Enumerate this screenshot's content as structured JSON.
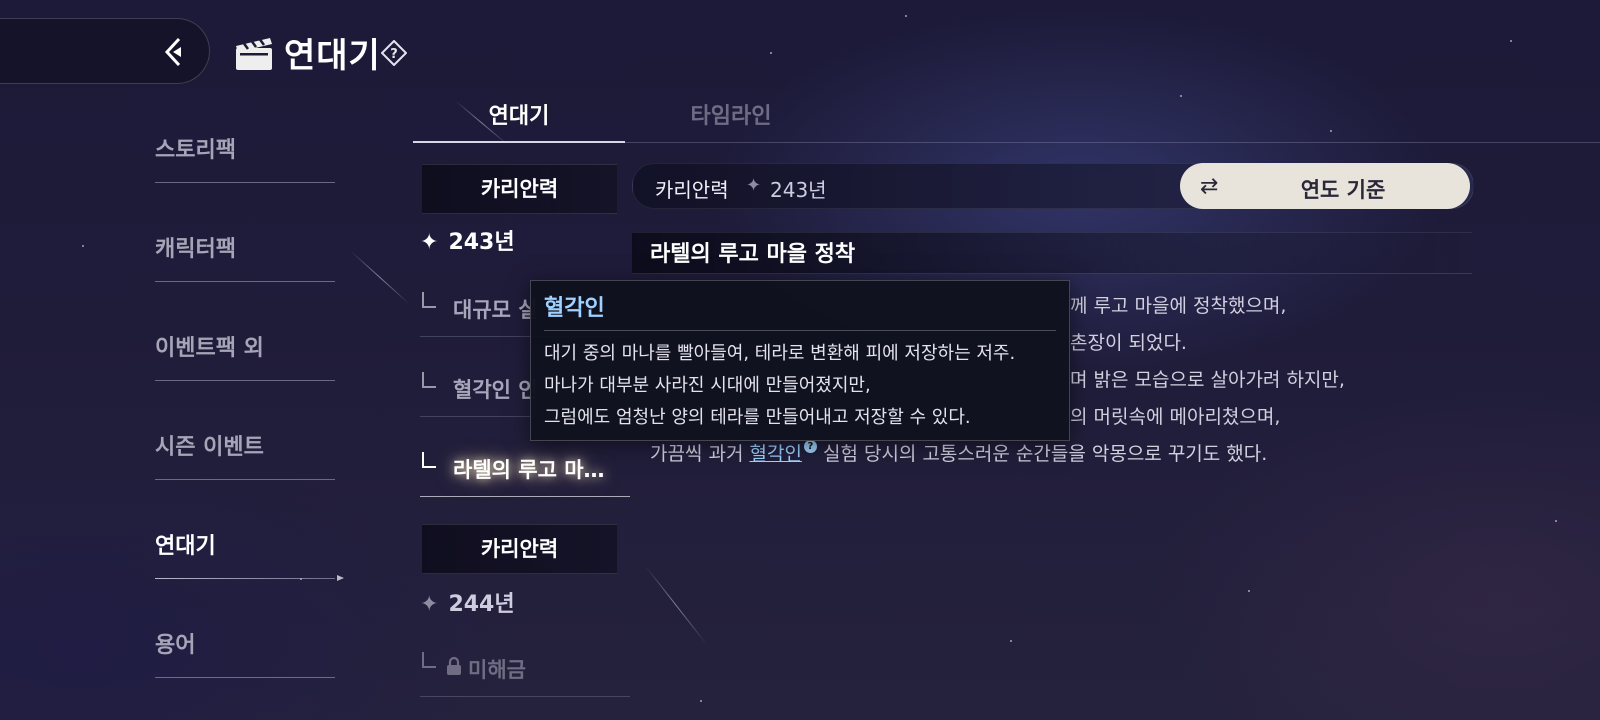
{
  "header": {
    "title": "연대기"
  },
  "sidebar": {
    "items": [
      {
        "label": "스토리팩"
      },
      {
        "label": "캐릭터팩"
      },
      {
        "label": "이벤트팩 외"
      },
      {
        "label": "시즌 이벤트"
      },
      {
        "label": "연대기"
      },
      {
        "label": "용어"
      }
    ],
    "active_index": 4
  },
  "tabs": [
    {
      "label": "연대기",
      "active": true
    },
    {
      "label": "타임라인",
      "active": false
    }
  ],
  "chronicle": {
    "groups": [
      {
        "era": "카리안력",
        "year": "243년",
        "entries": [
          {
            "title": "대규모 실",
            "state": "normal"
          },
          {
            "title": "혈각인 인",
            "state": "normal"
          },
          {
            "title": "라텔의 루고 마…",
            "state": "active"
          }
        ]
      },
      {
        "era": "카리안력",
        "year": "244년",
        "entries": [
          {
            "title": "미해금",
            "state": "locked"
          }
        ]
      }
    ]
  },
  "content": {
    "breadcrumb_era": "카리안력",
    "breadcrumb_year": "243년",
    "sort_button_label": "연도 기준",
    "entry_title": "라텔의 루고 마을 정착",
    "paragraph_fragments": [
      "께 루고 마을에 정착했으며,",
      "촌장이 되었다.",
      "며 밝은 모습으로 살아가려 하지만,",
      "의 머릿속에 메아리쳤으며,"
    ],
    "last_line_prefix": "가끔씩 과거 ",
    "last_line_keyword": "혈각인",
    "last_line_suffix": " 실험 당시의 고통스러운 순간들을 악몽으로 꾸기도 했다."
  },
  "tooltip": {
    "title": "혈각인",
    "lines": [
      "대기 중의 마나를 빨아들여, 테라로 변환해 피에 저장하는 저주.",
      "마나가 대부분 사라진 시대에 만들어졌지만,",
      "그럼에도 엄청난 양의 테라를 만들어내고 저장할 수 있다."
    ]
  },
  "colors": {
    "background": "#1f1c3a",
    "keyword": "#9fd2ff",
    "sort_button_bg": "#e8e4dc"
  },
  "icons": [
    "back-arrow-icon",
    "clapperboard-icon",
    "help-icon",
    "sparkle-icon",
    "swap-icon",
    "lock-icon"
  ]
}
